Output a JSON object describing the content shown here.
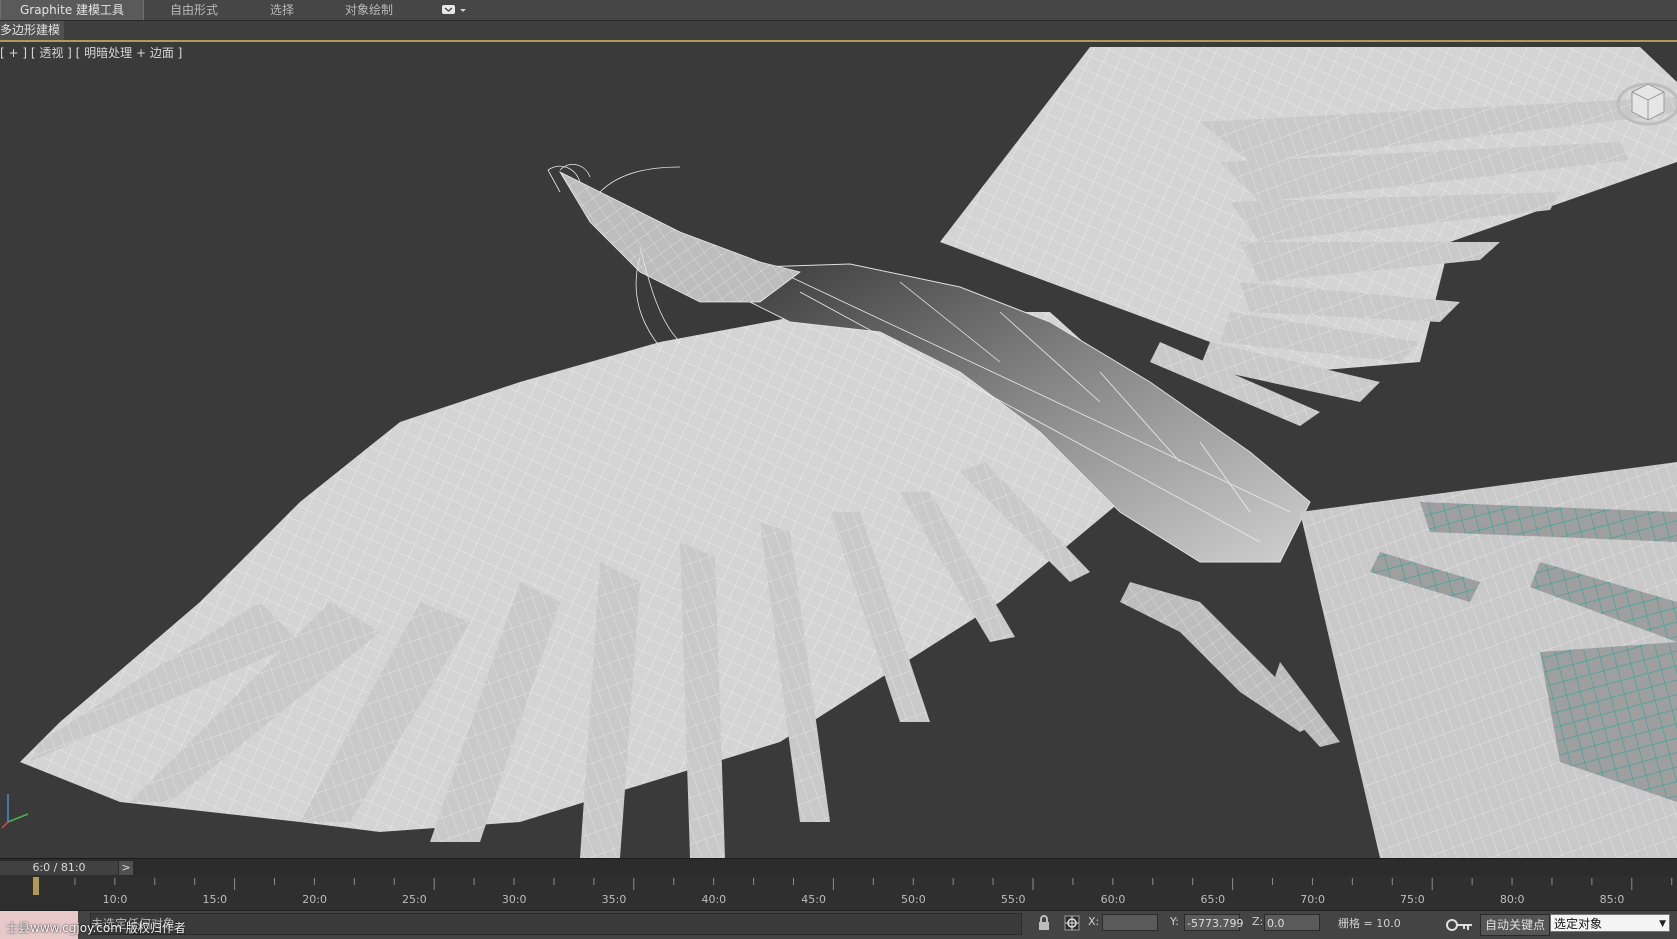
{
  "ribbon": {
    "tabs": [
      {
        "label": "Graphite 建模工具",
        "active": true
      },
      {
        "label": "自由形式",
        "active": false
      },
      {
        "label": "选择",
        "active": false
      },
      {
        "label": "对象绘制",
        "active": false
      }
    ]
  },
  "subbar": {
    "tab_label": "多边形建模"
  },
  "viewport": {
    "label": "[ + ] [ 透视 ] [ 明暗处理 + 边面 ]",
    "background": "#3a3a3a",
    "model_color": "#d9d9d9",
    "selected_color": "#2aa89a"
  },
  "timeline": {
    "frame_display": "6:0 / 81:0",
    "next_button": ">",
    "ticks": [
      "10:0",
      "15:0",
      "20:0",
      "25:0",
      "30:0",
      "35:0",
      "40:0",
      "45:0",
      "50:0",
      "55:0",
      "60:0",
      "65:0",
      "70:0",
      "75:0",
      "80:0",
      "85:0"
    ]
  },
  "status": {
    "watermark": "士县www.cgjoy.com 版权归作者",
    "message": "未选定任何对象",
    "x_label": "X:",
    "x_value": "",
    "y_label": "Y:",
    "y_value": "-5773.799",
    "z_label": "Z:",
    "z_value": "0.0",
    "grid": "栅格 = 10.0",
    "auto_key": "自动关键点",
    "selection": "选定对象"
  }
}
